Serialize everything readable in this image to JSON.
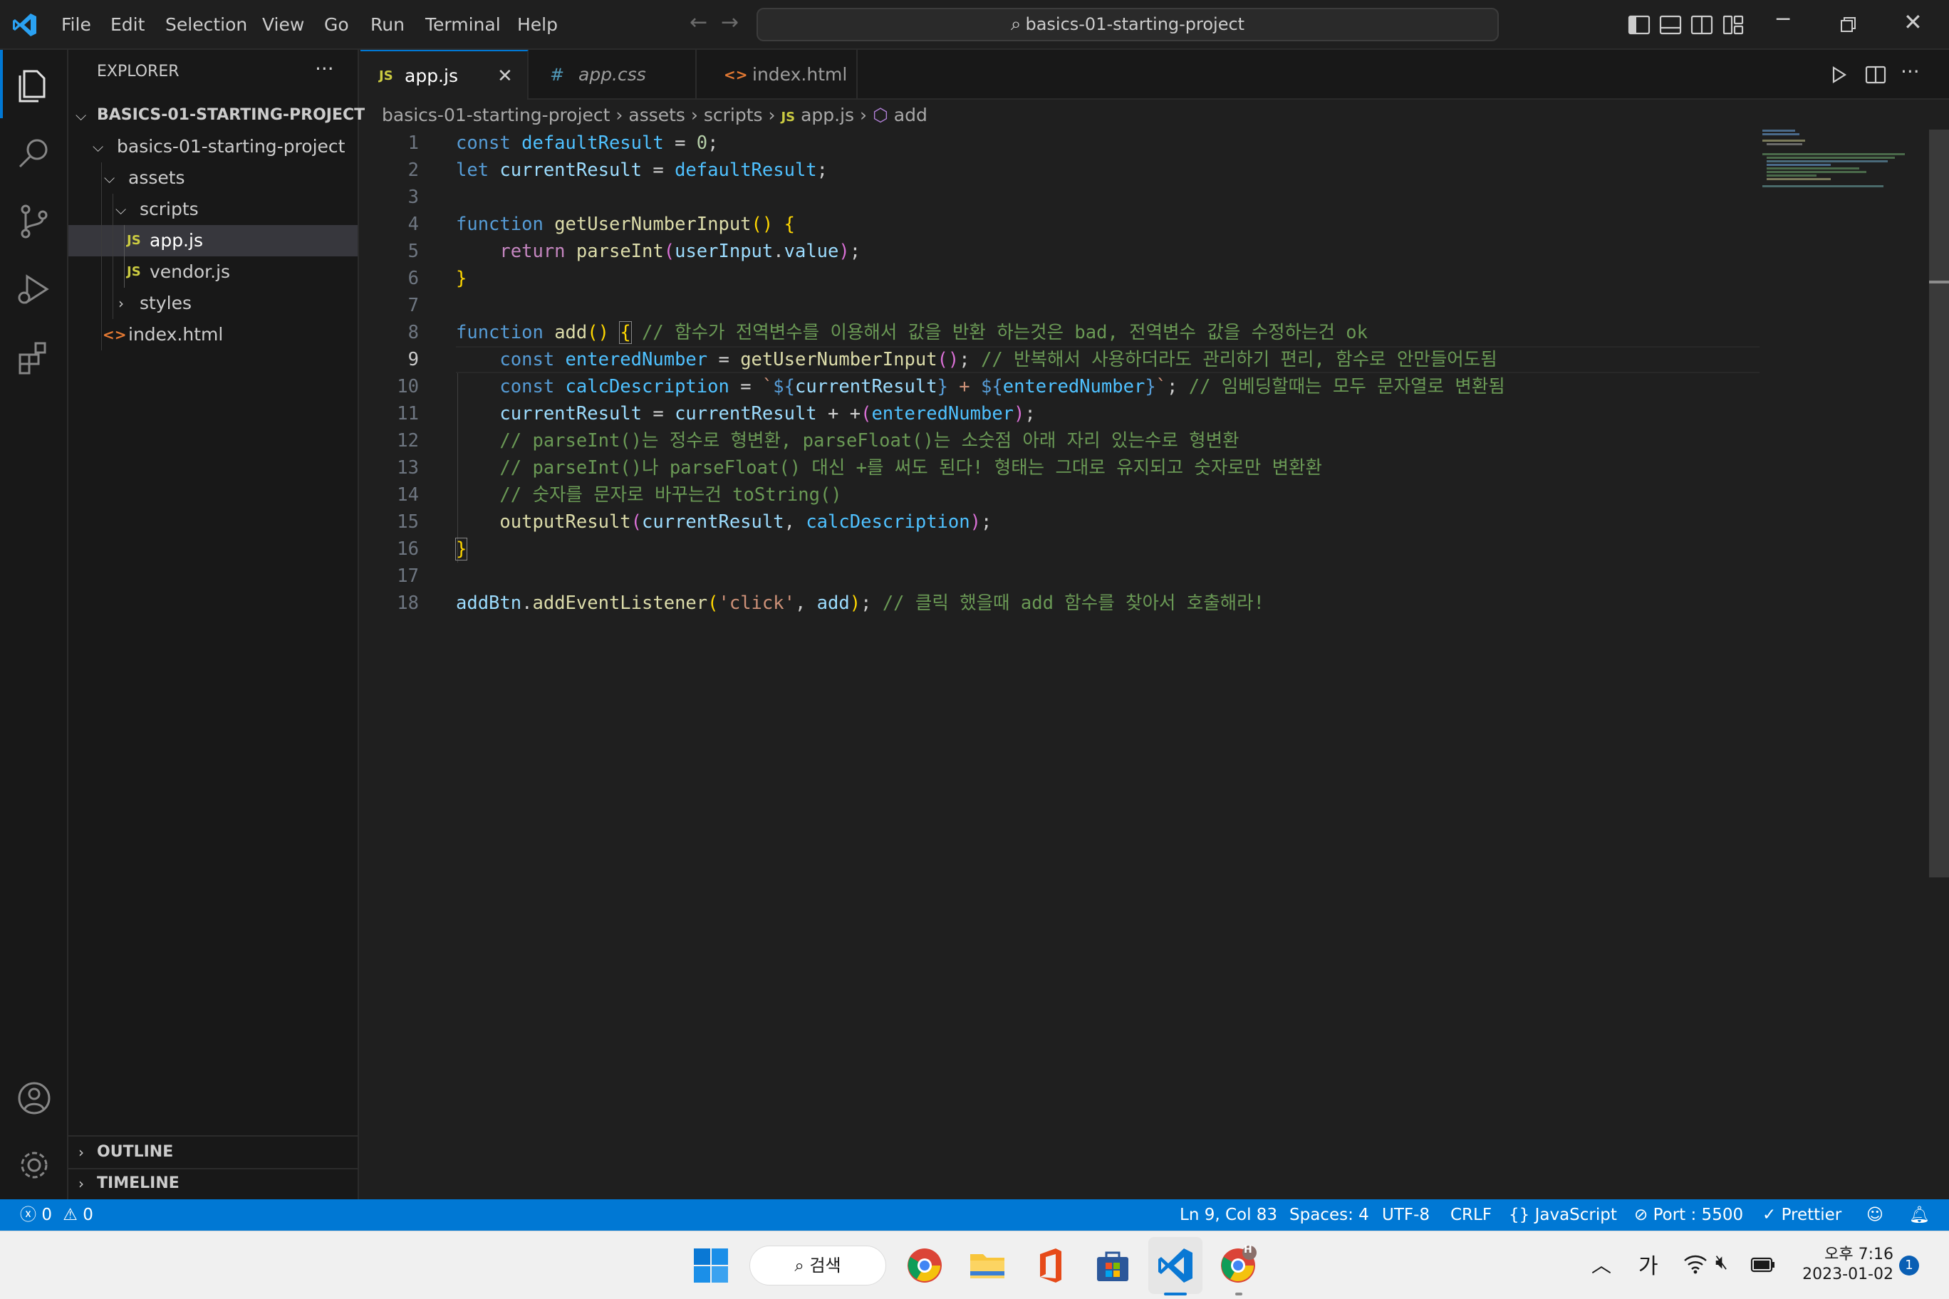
{
  "menu": {
    "items": [
      "File",
      "Edit",
      "Selection",
      "View",
      "Go",
      "Run",
      "Terminal",
      "Help"
    ]
  },
  "search": {
    "text": "basics-01-starting-project"
  },
  "sidebar": {
    "title": "EXPLORER",
    "root": "BASICS-01-STARTING-PROJECT",
    "folder": "basics-01-starting-project",
    "assets": "assets",
    "scripts": "scripts",
    "app_js": "app.js",
    "vendor_js": "vendor.js",
    "styles": "styles",
    "index_html": "index.html",
    "js_badge": "JS",
    "outline": "OUTLINE",
    "timeline": "TIMELINE"
  },
  "tabs": [
    {
      "icon": "JS",
      "label": "app.js"
    },
    {
      "icon": "#",
      "label": "app.css"
    },
    {
      "icon": "<>",
      "label": "index.html"
    }
  ],
  "breadcrumb": {
    "p1": "basics-01-starting-project",
    "p2": "assets",
    "p3": "scripts",
    "icon": "JS",
    "p4": "app.js",
    "p5": "add"
  },
  "code": {
    "line_numbers": [
      "1",
      "2",
      "3",
      "4",
      "5",
      "6",
      "7",
      "8",
      "9",
      "10",
      "11",
      "12",
      "13",
      "14",
      "15",
      "16",
      "17",
      "18"
    ],
    "l1": {
      "a": "const",
      "b": "defaultResult",
      "c": " = ",
      "d": "0",
      "e": ";"
    },
    "l2": {
      "a": "let",
      "b": "currentResult",
      "c": " = ",
      "d": "defaultResult",
      "e": ";"
    },
    "l4": {
      "a": "function",
      "b": "getUserNumberInput",
      "c": "()",
      "d": " {"
    },
    "l5": {
      "a": "return",
      "b": "parseInt",
      "c": "(",
      "d": "userInput",
      "e": ".",
      "f": "value",
      "g": ")",
      "h": ";"
    },
    "l6": {
      "a": "}"
    },
    "l8": {
      "a": "function",
      "b": "add",
      "c": "()",
      "d": "{",
      "e": "// 함수가 전역변수를 이용해서 값을 반환 하는것은 bad, 전역변수 값을 수정하는건 ok"
    },
    "l9": {
      "a": "const",
      "b": "enteredNumber",
      "c": " = ",
      "d": "getUserNumberInput",
      "e": "()",
      "f": ";",
      "g": "// 반복해서 사용하더라도 관리하기 편리, 함수로 안만들어도됨"
    },
    "l10": {
      "a": "const",
      "b": "calcDescription",
      "c": " = ",
      "d": "`",
      "e": "${",
      "f": "currentResult",
      "g": "}",
      "h": " + ",
      "i": "${",
      "j": "enteredNumber",
      "k": "}",
      "l": "`",
      "m": ";",
      "n": "// 임베딩할때는 모두 문자열로 변환됨"
    },
    "l11": {
      "a": "currentResult",
      "b": " = ",
      "c": "currentResult",
      "d": " + +",
      "e": "(",
      "f": "enteredNumber",
      "g": ")",
      "h": ";"
    },
    "l12": {
      "a": "// parseInt()는 정수로 형변환, parseFloat()는 소숫점 아래 자리 있는수로 형변환"
    },
    "l13": {
      "a": "// parseInt()나 parseFloat() 대신 +를 써도 된다! 형태는 그대로 유지되고 숫자로만 변환환"
    },
    "l14": {
      "a": "// 숫자를 문자로 바꾸는건 toString()"
    },
    "l15": {
      "a": "outputResult",
      "b": "(",
      "c": "currentResult",
      "d": ", ",
      "e": "calcDescription",
      "f": ")",
      "g": ";"
    },
    "l16": {
      "a": "}"
    },
    "l18": {
      "a": "addBtn",
      "b": ".",
      "c": "addEventListener",
      "d": "(",
      "e": "'click'",
      "f": ", ",
      "g": "add",
      "h": ")",
      "i": ";",
      "j": "// 클릭 했을때 add 함수를 찾아서 호출해라!"
    }
  },
  "status": {
    "errors": "0",
    "warnings": "0",
    "position": "Ln 9, Col 83",
    "spaces": "Spaces: 4",
    "encoding": "UTF-8",
    "eol": "CRLF",
    "language": "JavaScript",
    "port": "Port : 5500",
    "prettier": "Prettier"
  },
  "taskbar": {
    "search": "검색",
    "ime": "가",
    "time": "오후 7:16",
    "date": "2023-01-02",
    "notification_count": "1",
    "chrome_profile": "H"
  },
  "colors": {
    "accent": "#0078d4",
    "editor_bg": "#1f1f1f",
    "sidebar_bg": "#181818"
  }
}
